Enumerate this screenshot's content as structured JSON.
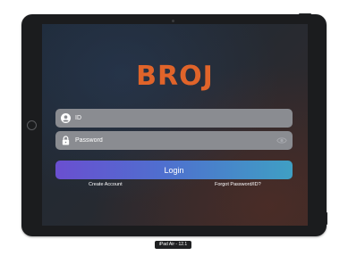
{
  "device": {
    "label": "iPad Air - 12.1"
  },
  "app": {
    "logo_text": "BROJ",
    "brand_color": "#e0642a"
  },
  "login_form": {
    "id_field": {
      "placeholder": "ID",
      "value": "",
      "icon": "user-icon"
    },
    "password_field": {
      "placeholder": "Password",
      "value": "",
      "icon": "lock-icon",
      "toggle_icon": "eye-icon"
    },
    "login_button": {
      "label": "Login"
    },
    "create_account_link": "Create Account",
    "forgot_link": "Forgot Password/ID?"
  }
}
